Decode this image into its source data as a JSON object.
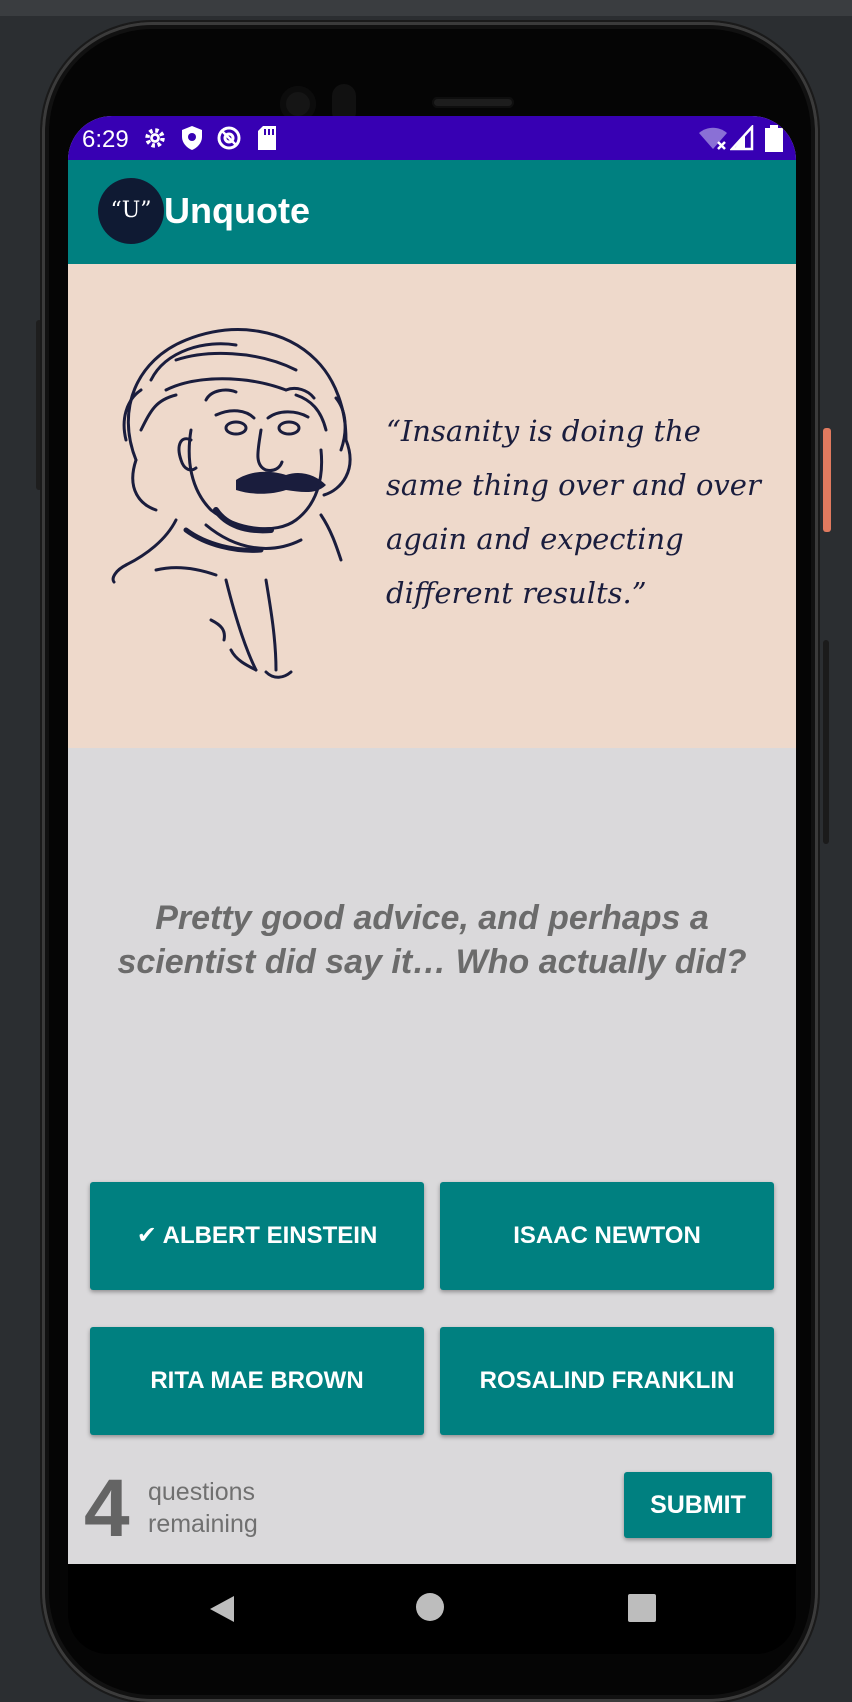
{
  "status_bar": {
    "time": "6:29",
    "icons": [
      "gear-icon",
      "shield-icon",
      "at-sign-icon",
      "sd-card-icon",
      "wifi-off-icon",
      "signal-icon",
      "battery-icon"
    ]
  },
  "app_bar": {
    "title": "Unquote",
    "logo_text": "“U”",
    "color": "#008080"
  },
  "quote": {
    "text": "“Insanity is doing the same thing over and over again and expecting different results.”"
  },
  "question": {
    "text": "Pretty good advice, and perhaps a scientist did say it… Who actually did?"
  },
  "answers": [
    {
      "label": "✔ ALBERT EINSTEIN",
      "selected": true
    },
    {
      "label": "ISAAC NEWTON",
      "selected": false
    },
    {
      "label": "RITA MAE BROWN",
      "selected": false
    },
    {
      "label": "ROSALIND FRANKLIN",
      "selected": false
    }
  ],
  "footer": {
    "count": "4",
    "remaining_line1": "questions",
    "remaining_line2": "remaining",
    "submit_label": "SUBMIT"
  },
  "colors": {
    "status_bar": "#3700b3",
    "accent": "#008080",
    "quote_background": "#eed9cb",
    "body_background": "#dad9db"
  }
}
